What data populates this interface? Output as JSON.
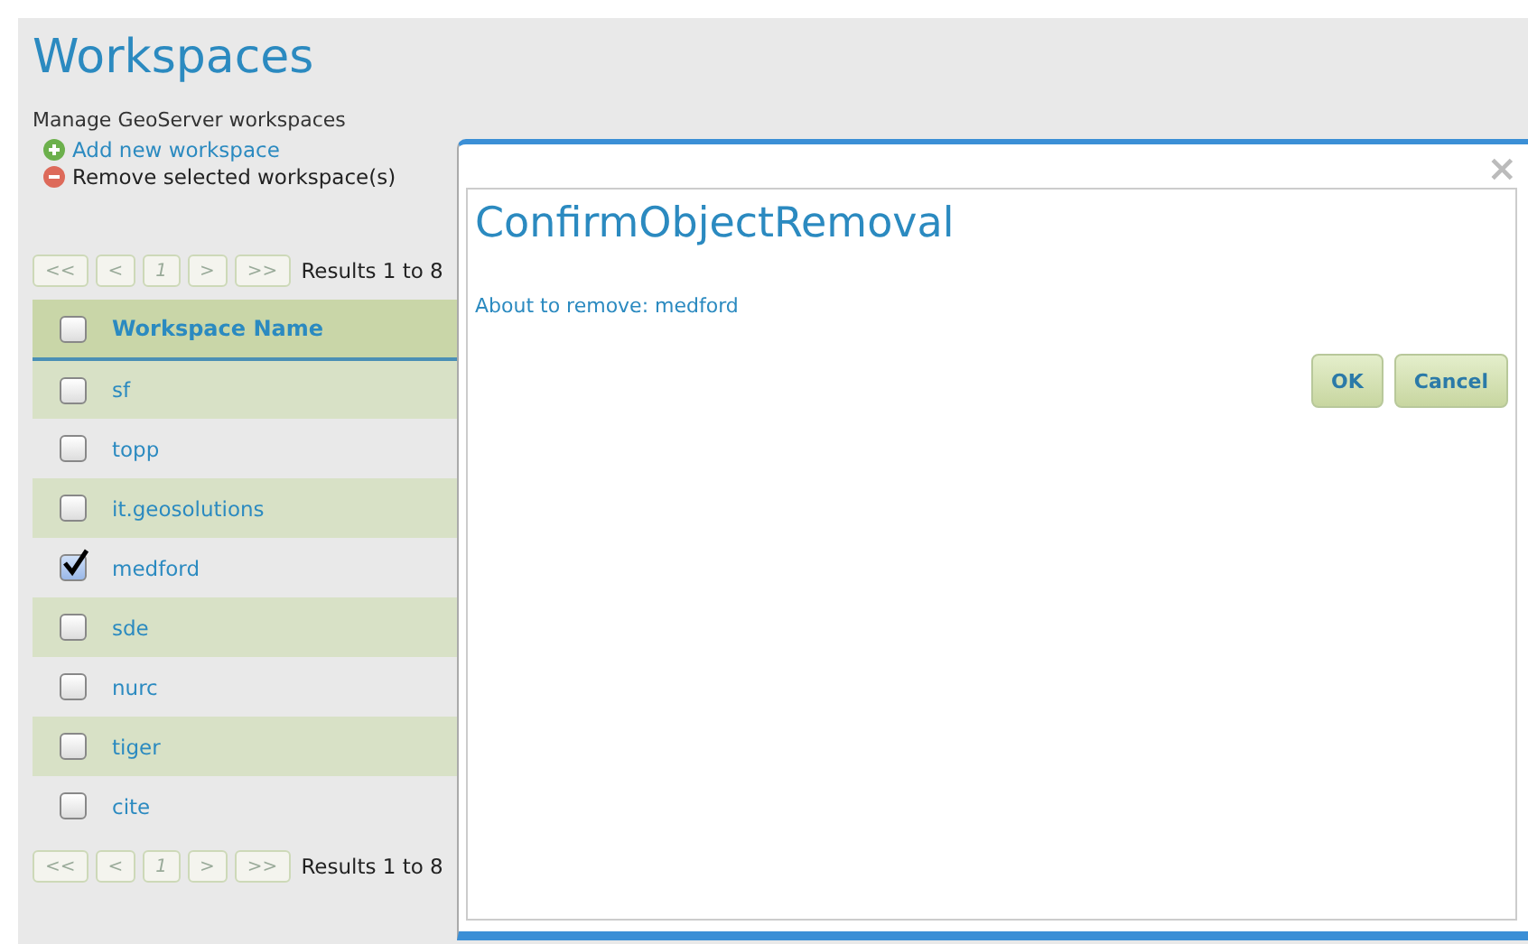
{
  "page": {
    "title": "Workspaces",
    "description": "Manage GeoServer workspaces",
    "actions": [
      {
        "kind": "add",
        "label": "Add new workspace"
      },
      {
        "kind": "remove",
        "label": "Remove selected workspace(s)"
      }
    ]
  },
  "pager_top": {
    "buttons": [
      "<<",
      "<",
      "1",
      ">",
      ">>"
    ],
    "summary": "Results 1 to 8"
  },
  "table": {
    "header": {
      "checked": false,
      "label": "Workspace Name"
    },
    "rows": [
      {
        "name": "sf",
        "checked": false
      },
      {
        "name": "topp",
        "checked": false
      },
      {
        "name": "it.geosolutions",
        "checked": false
      },
      {
        "name": "medford",
        "checked": true
      },
      {
        "name": "sde",
        "checked": false
      },
      {
        "name": "nurc",
        "checked": false
      },
      {
        "name": "tiger",
        "checked": false
      },
      {
        "name": "cite",
        "checked": false
      }
    ]
  },
  "pager_bottom": {
    "buttons": [
      "<<",
      "<",
      "1",
      ">",
      ">>"
    ],
    "summary": "Results 1 to 8"
  },
  "dialog": {
    "close": "×",
    "title": "ConfirmObjectRemoval",
    "message": "About to remove: medford",
    "buttons": [
      "OK",
      "Cancel"
    ]
  }
}
